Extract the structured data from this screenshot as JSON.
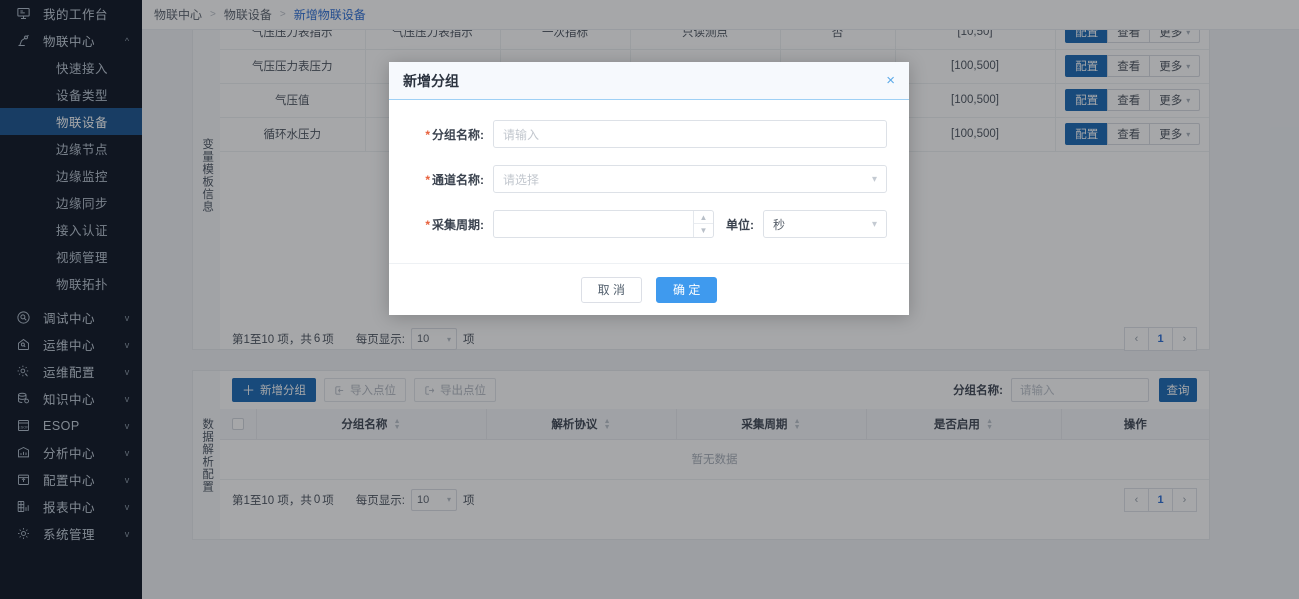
{
  "sidebar": {
    "items": [
      {
        "label": "我的工作台",
        "icon": "workbench-icon",
        "expandable": false,
        "arrow": ""
      },
      {
        "label": "物联中心",
        "icon": "robot-arm-icon",
        "expandable": true,
        "arrow": "^"
      },
      {
        "label": "调试中心",
        "icon": "debug-icon",
        "expandable": true,
        "arrow": "v"
      },
      {
        "label": "运维中心",
        "icon": "ops-home-icon",
        "expandable": true,
        "arrow": "v"
      },
      {
        "label": "运维配置",
        "icon": "ops-gear-icon",
        "expandable": true,
        "arrow": "v"
      },
      {
        "label": "知识中心",
        "icon": "knowledge-db-icon",
        "expandable": true,
        "arrow": "v"
      },
      {
        "label": "ESOP",
        "icon": "esop-icon",
        "expandable": true,
        "arrow": "v"
      },
      {
        "label": "分析中心",
        "icon": "analytics-icon",
        "expandable": true,
        "arrow": "v"
      },
      {
        "label": "配置中心",
        "icon": "config-box-icon",
        "expandable": true,
        "arrow": "v"
      },
      {
        "label": "报表中心",
        "icon": "report-icon",
        "expandable": true,
        "arrow": "v"
      },
      {
        "label": "系统管理",
        "icon": "system-gear-icon",
        "expandable": true,
        "arrow": "v"
      }
    ],
    "subitems": [
      {
        "label": "快速接入",
        "active": false
      },
      {
        "label": "设备类型",
        "active": false
      },
      {
        "label": "物联设备",
        "active": true
      },
      {
        "label": "边缘节点",
        "active": false
      },
      {
        "label": "边缘监控",
        "active": false
      },
      {
        "label": "边缘同步",
        "active": false
      },
      {
        "label": "接入认证",
        "active": false
      },
      {
        "label": "视频管理",
        "active": false
      },
      {
        "label": "物联拓扑",
        "active": false
      }
    ]
  },
  "breadcrumb": {
    "items": [
      "物联中心",
      "物联设备",
      "新增物联设备"
    ],
    "separator": ">"
  },
  "upper_panel": {
    "side_label": "变量模板信息",
    "rows": [
      {
        "name": "气压压力表指示",
        "alias": "气压压力表指示",
        "kind": "一次指标",
        "type": "只读测点",
        "flag": "否",
        "range": "[10,50]"
      },
      {
        "name": "气压压力表压力",
        "alias": "",
        "kind": "",
        "type": "",
        "flag": "",
        "range": "[100,500]"
      },
      {
        "name": "气压值",
        "alias": "",
        "kind": "",
        "type": "",
        "flag": "",
        "range": "[100,500]"
      },
      {
        "name": "循环水压力",
        "alias": "",
        "kind": "",
        "type": "",
        "flag": "",
        "range": "[100,500]"
      }
    ],
    "row_actions": {
      "config": "配置",
      "view": "查看",
      "more": "更多"
    },
    "pager": {
      "summary_prefix": "第1至10 项，共",
      "total": "6",
      "summary_suffix": "项",
      "per_page_label": "每页显示:",
      "per_page_value": "10",
      "per_page_unit": "项",
      "prev": "‹",
      "current": "1",
      "next": "›"
    }
  },
  "lower_panel": {
    "side_label": "数据解析配置",
    "toolbar": {
      "add_group": "新增分组",
      "import_points": "导入点位",
      "export_points": "导出点位",
      "search_label": "分组名称:",
      "search_placeholder": "请输入",
      "search_button": "查询"
    },
    "columns": [
      "分组名称",
      "解析协议",
      "采集周期",
      "是否启用",
      "操作"
    ],
    "empty_text": "暂无数据",
    "pager": {
      "summary_prefix": "第1至10 项，共",
      "total": "0",
      "summary_suffix": "项",
      "per_page_label": "每页显示:",
      "per_page_value": "10",
      "per_page_unit": "项",
      "prev": "‹",
      "current": "1",
      "next": "›"
    }
  },
  "modal": {
    "title": "新增分组",
    "close_icon": "×",
    "fields": {
      "group_name": {
        "label": "分组名称:",
        "placeholder": "请输入",
        "required": "*"
      },
      "channel_name": {
        "label": "通道名称:",
        "placeholder": "请选择",
        "required": "*"
      },
      "collect_period": {
        "label": "采集周期:",
        "value": "",
        "required": "*"
      },
      "unit": {
        "label": "单位:",
        "value": "秒"
      }
    },
    "cancel": "取 消",
    "confirm": "确 定"
  },
  "colors": {
    "sidebar_bg": "#0d1624",
    "sidebar_active": "#1a5590",
    "accent_blue": "#2d6fd6",
    "primary_button": "#1a6ab5",
    "modal_confirm": "#3f9aee",
    "required_red": "#e8603c"
  }
}
